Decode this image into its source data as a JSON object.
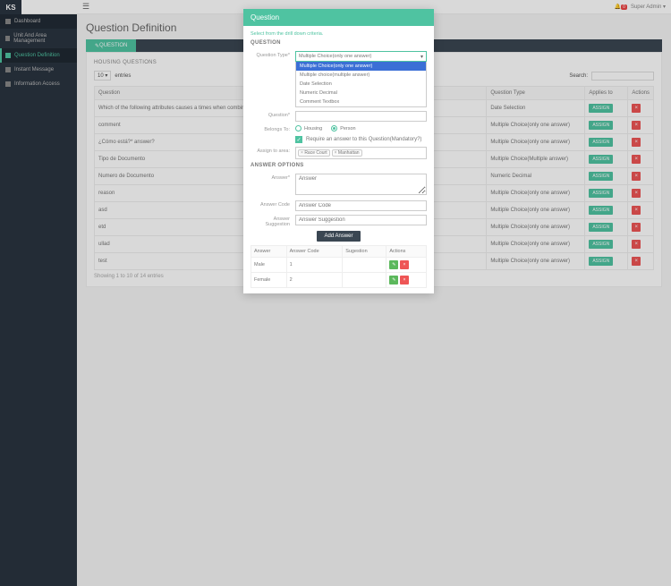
{
  "brand": "KS",
  "user": "Super Admin ▾",
  "notif_count": "0",
  "sidebar": {
    "items": [
      {
        "label": "Dashboard"
      },
      {
        "label": "Unit And Area Management"
      },
      {
        "label": "Question Definition"
      },
      {
        "label": "Instant Message"
      },
      {
        "label": "Information Access"
      }
    ]
  },
  "page_title": "Question Definition",
  "tab_label": "QUESTION",
  "panel_head": "HOUSING QUESTIONS",
  "entries_label": "entries",
  "search_label": "Search:",
  "columns": {
    "q": "Question",
    "qt": "Question Type",
    "ap": "Applies to",
    "ac": "Actions"
  },
  "rows": [
    {
      "q": "Which of the following attributes causes a times when combined Races (i.e …",
      "qt": "Date Selection"
    },
    {
      "q": "comment",
      "qt": "Multiple Choice(only one answer)"
    },
    {
      "q": "¿Cómo está?* answer?",
      "qt": "Multiple Choice(only one answer)"
    },
    {
      "q": "Tipo de Documento",
      "qt": "Multiple Choice(Multiple answer)"
    },
    {
      "q": "Numero de Documento",
      "qt": "Numeric Decimal"
    },
    {
      "q": "reason",
      "qt": "Multiple Choice(only one answer)"
    },
    {
      "q": "asd",
      "qt": "Multiple Choice(only one answer)"
    },
    {
      "q": "etd",
      "qt": "Multiple Choice(only one answer)"
    },
    {
      "q": "ullad",
      "qt": "Multiple Choice(only one answer)"
    },
    {
      "q": "test",
      "qt": "Multiple Choice(only one answer)"
    }
  ],
  "assign_btn": "ASSIGN",
  "showing": "Showing 1 to 10 of 14 entries",
  "modal": {
    "title": "Question",
    "hint": "Select from the drill down criteria.",
    "sect1": "QUESTION",
    "qtype_label": "Question Type*",
    "qtype_value": "Multiple Choice(only one answer)",
    "options": [
      "Multiple Choice(only one answer)",
      "Multiple choice(multiple answer)",
      "Date Selection",
      "Numeric Decimal",
      "Comment Textbox"
    ],
    "question_label": "Question*",
    "belongs_label": "Belongs To:",
    "belongs_opts": {
      "housing": "Housing",
      "person": "Person"
    },
    "mandatory": "Require an answer to this Question(Mandatory?)",
    "assign_label": "Assign to area:",
    "assign_tags": [
      "Race Court",
      "Manhattan"
    ],
    "sect2": "ANSWER OPTIONS",
    "answer_label": "Answer*",
    "answer_ph": "Answer",
    "code_label": "Answer Code",
    "code_ph": "Answer Code",
    "sugg_label": "Answer Suggestion",
    "sugg_ph": "Answer Suggestion",
    "add_btn": "Add Answer",
    "cols": {
      "a": "Answer",
      "c": "Answer Code",
      "s": "Sugestion",
      "ac": "Actions"
    },
    "answers": [
      {
        "a": "Male",
        "c": "1",
        "s": ""
      },
      {
        "a": "Female",
        "c": "2",
        "s": ""
      }
    ]
  }
}
